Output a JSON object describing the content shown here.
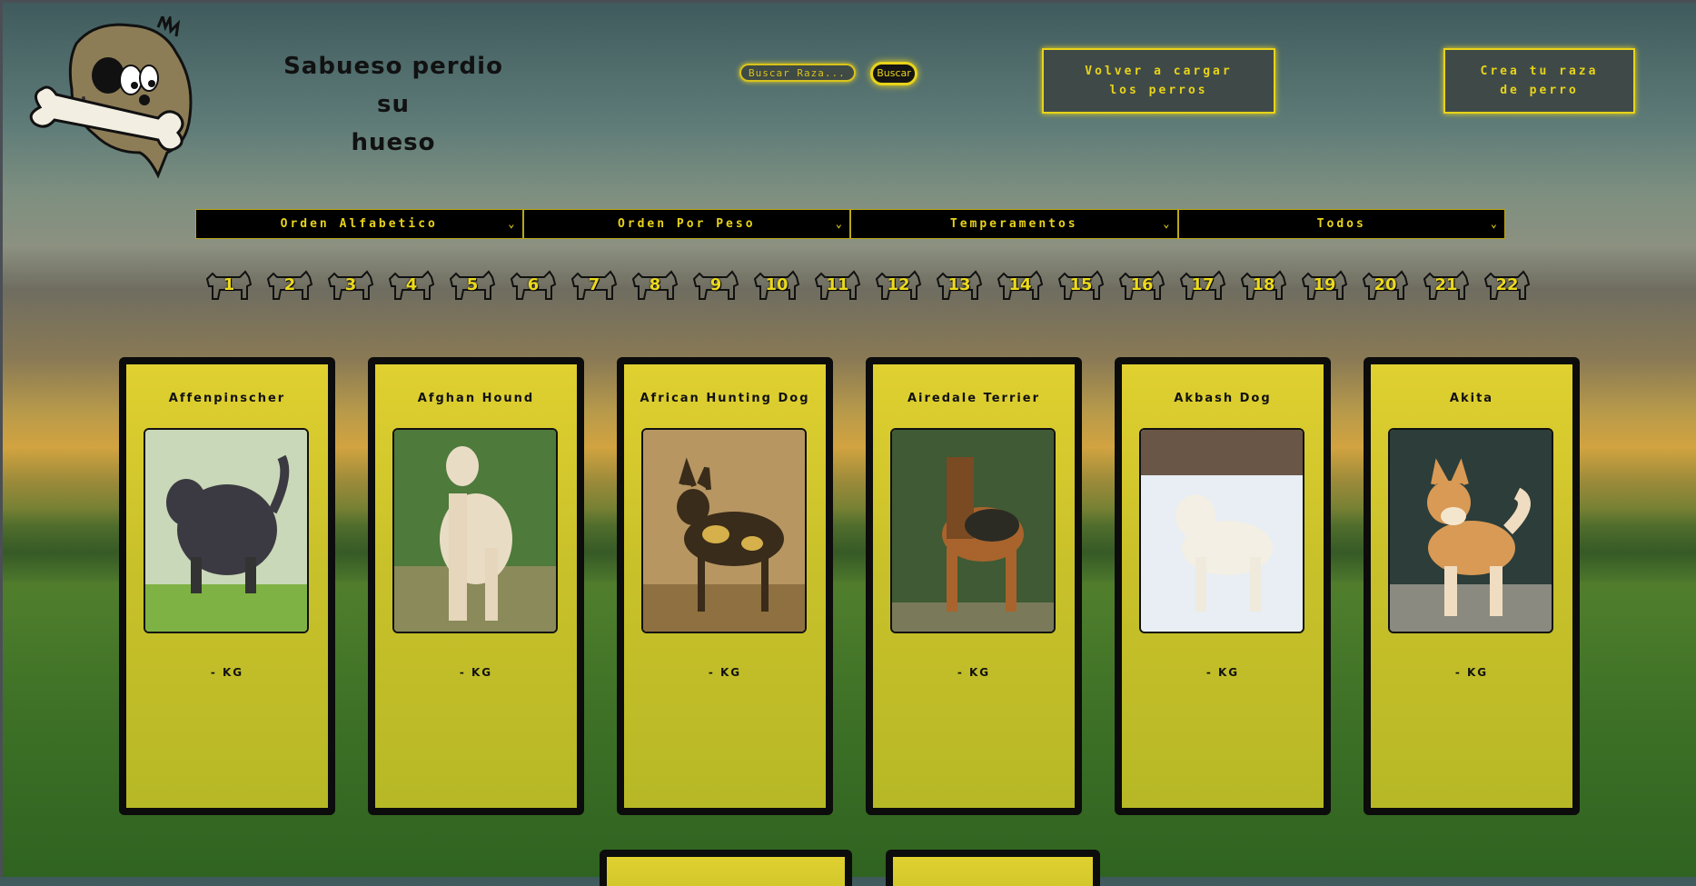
{
  "header": {
    "title_line1": "Sabueso perdio su",
    "title_line2": "hueso",
    "search_placeholder": "Buscar Raza...",
    "search_button": "Buscar",
    "reload_button": "Volver a cargar los perros",
    "create_button": "Crea tu raza de perro"
  },
  "filters": [
    {
      "label": "Orden Alfabetico"
    },
    {
      "label": "Orden Por Peso"
    },
    {
      "label": "Temperamentos"
    },
    {
      "label": "Todos"
    }
  ],
  "pagination": [
    "1",
    "2",
    "3",
    "4",
    "5",
    "6",
    "7",
    "8",
    "9",
    "10",
    "11",
    "12",
    "13",
    "14",
    "15",
    "16",
    "17",
    "18",
    "19",
    "20",
    "21",
    "22"
  ],
  "cards": [
    {
      "name": "Affenpinscher",
      "weight": "- KG",
      "photo": "dog-photo-affenpinscher"
    },
    {
      "name": "Afghan Hound",
      "weight": "- KG",
      "photo": "dog-photo-afghan-hound"
    },
    {
      "name": "African Hunting Dog",
      "weight": "- KG",
      "photo": "dog-photo-african-hunting-dog"
    },
    {
      "name": "Airedale Terrier",
      "weight": "- KG",
      "photo": "dog-photo-airedale-terrier"
    },
    {
      "name": "Akbash Dog",
      "weight": "- KG",
      "photo": "dog-photo-akbash-dog"
    },
    {
      "name": "Akita",
      "weight": "- KG",
      "photo": "dog-photo-akita"
    }
  ],
  "colors": {
    "accent": "#e8d31a",
    "card_frame": "#0c0c0c",
    "button_bg": "#3f4a48"
  }
}
